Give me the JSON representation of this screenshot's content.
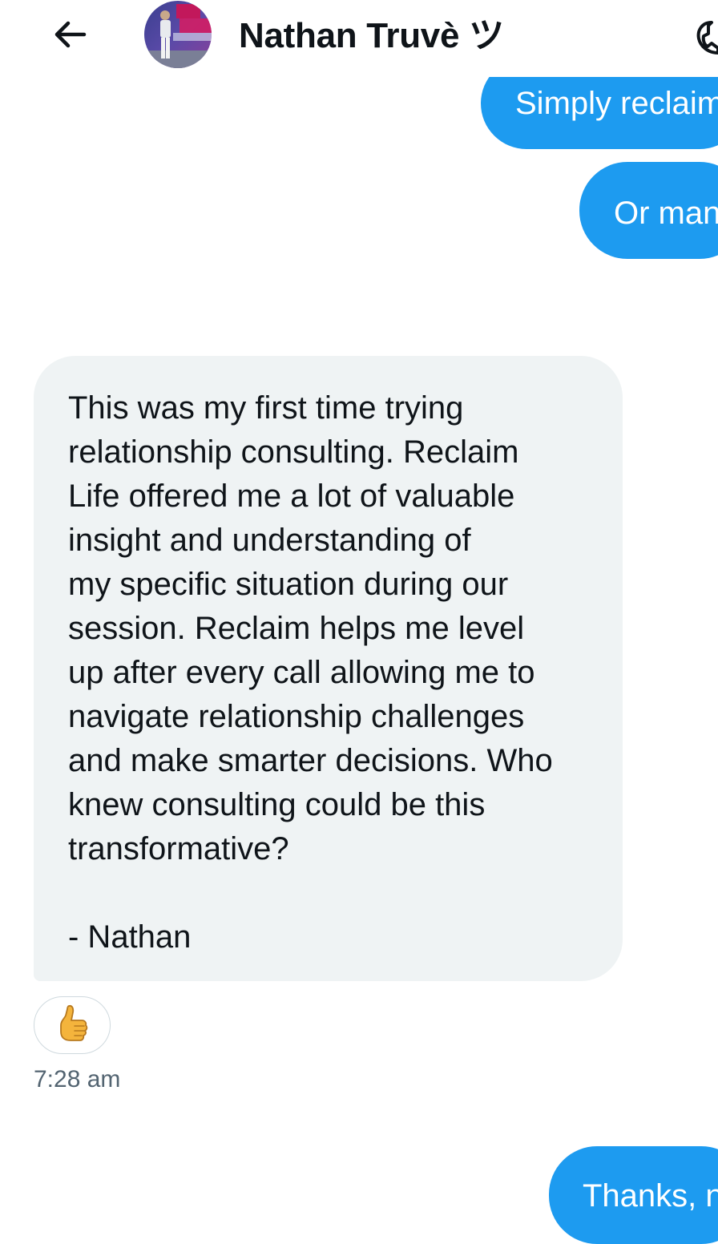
{
  "header": {
    "back_icon": "arrow-left-icon",
    "contact_name": "Nathan Truvè ツ",
    "avatar_icon": "profile-photo",
    "call_icon": "phone-icon"
  },
  "messages": {
    "outgoing_1": "Simply reclaim",
    "outgoing_2": "Or man",
    "incoming": {
      "lines": [
        "This was my first time trying",
        "relationship consulting. Reclaim",
        "Life offered me a lot of valuable",
        "insight and understanding of",
        "my specific situation during our",
        "session. Reclaim helps me level",
        "up after every call allowing me to",
        "navigate relationship challenges",
        "and make smarter decisions. Who",
        "knew consulting could be this",
        "transformative?",
        "",
        "- Nathan"
      ],
      "reaction_icon": "thumbs-up-icon",
      "timestamp": "7:28 am"
    },
    "outgoing_3": "Thanks, n"
  },
  "colors": {
    "outgoing_bubble": "#1d9bf0",
    "incoming_bubble": "#eff3f4",
    "timestamp_text": "#536471",
    "reaction_border": "#cfd9de"
  }
}
